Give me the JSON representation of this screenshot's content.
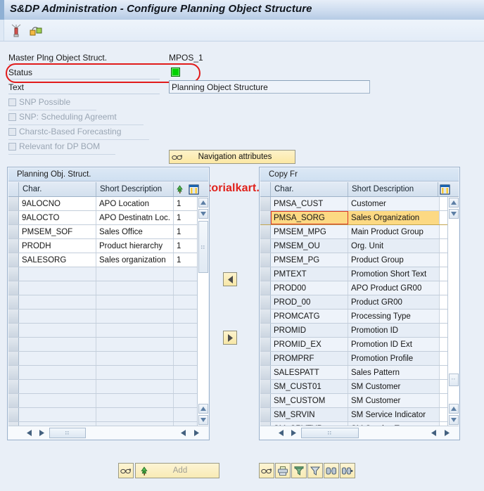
{
  "window": {
    "title": "S&DP Administration - Configure Planning Object Structure"
  },
  "toolbar": {
    "icons": [
      {
        "name": "hierarchy-display-icon",
        "title": "Display"
      },
      {
        "name": "objects-link-icon",
        "title": "Objects"
      }
    ]
  },
  "form": {
    "mpos": {
      "label": "Master Plng Object Struct.",
      "value": "MPOS_1"
    },
    "status": {
      "label": "Status",
      "led_color": "#00d200",
      "highlighted": true
    },
    "text": {
      "label": "Text",
      "value": "Planning Object Structure",
      "placeholder": ""
    },
    "checkboxes": [
      {
        "label": "SNP Possible",
        "checked": false,
        "enabled": false
      },
      {
        "label": "SNP: Scheduling Agreemt",
        "checked": false,
        "enabled": false
      },
      {
        "label": "Charstc-Based Forecasting",
        "checked": false,
        "enabled": false
      },
      {
        "label": "Relevant for DP BOM",
        "checked": false,
        "enabled": false
      }
    ],
    "nav_button": {
      "label": "Navigation attributes",
      "icon": "glasses-icon"
    },
    "watermark": "www.tutorialkart.com"
  },
  "left_panel": {
    "caption": "Planning Obj. Struct.",
    "columns": [
      {
        "label": "Char.",
        "name": "char"
      },
      {
        "label": "Short Description",
        "name": "short-description"
      },
      {
        "label": "C",
        "name": "c",
        "icon": "hierarchy-tree-icon"
      }
    ],
    "config_icon": "table-settings-icon",
    "rows": [
      {
        "char": "9ALOCNO",
        "desc": "APO Location",
        "c": "1"
      },
      {
        "char": "9ALOCTO",
        "desc": "APO Destinatn Loc.",
        "c": "1"
      },
      {
        "char": "PMSEM_SOF",
        "desc": "Sales Office",
        "c": "1"
      },
      {
        "char": "PRODH",
        "desc": "Product hierarchy",
        "c": "1"
      },
      {
        "char": "SALESORG",
        "desc": "Sales organization",
        "c": "1"
      },
      {
        "char": "",
        "desc": "",
        "c": ""
      },
      {
        "char": "",
        "desc": "",
        "c": ""
      },
      {
        "char": "",
        "desc": "",
        "c": ""
      },
      {
        "char": "",
        "desc": "",
        "c": ""
      },
      {
        "char": "",
        "desc": "",
        "c": ""
      },
      {
        "char": "",
        "desc": "",
        "c": ""
      },
      {
        "char": "",
        "desc": "",
        "c": ""
      },
      {
        "char": "",
        "desc": "",
        "c": ""
      },
      {
        "char": "",
        "desc": "",
        "c": ""
      },
      {
        "char": "",
        "desc": "",
        "c": ""
      },
      {
        "char": "",
        "desc": "",
        "c": ""
      },
      {
        "char": "",
        "desc": "",
        "c": ""
      }
    ]
  },
  "right_panel": {
    "caption": "Copy Fr",
    "columns": [
      {
        "label": "Char.",
        "name": "char"
      },
      {
        "label": "Short Description",
        "name": "short-description"
      }
    ],
    "config_icon": "table-settings-icon",
    "selected_row_index": 1,
    "rows": [
      {
        "char": "PMSA_CUST",
        "desc": "Customer"
      },
      {
        "char": "PMSA_SORG",
        "desc": "Sales Organization"
      },
      {
        "char": "PMSEM_MPG",
        "desc": "Main Product Group"
      },
      {
        "char": "PMSEM_OU",
        "desc": "Org. Unit"
      },
      {
        "char": "PMSEM_PG",
        "desc": "Product Group"
      },
      {
        "char": "PMTEXT",
        "desc": "Promotion Short Text"
      },
      {
        "char": "PROD00",
        "desc": "APO Product GR00"
      },
      {
        "char": "PROD_00",
        "desc": "Product GR00"
      },
      {
        "char": "PROMCATG",
        "desc": "Processing Type"
      },
      {
        "char": "PROMID",
        "desc": "Promotion ID"
      },
      {
        "char": "PROMID_EX",
        "desc": "Promotion ID Ext"
      },
      {
        "char": "PROMPRF",
        "desc": "Promotion Profile"
      },
      {
        "char": "SALESPATT",
        "desc": "Sales Pattern"
      },
      {
        "char": "SM_CUST01",
        "desc": "SM Customer"
      },
      {
        "char": "SM_CUSTOM",
        "desc": "SM Customer"
      },
      {
        "char": "SM_SRVIN",
        "desc": "SM Service Indicator"
      },
      {
        "char": "SM_SRVTYP",
        "desc": "SM Service Type"
      }
    ]
  },
  "transfer": {
    "move_left_label": "◀",
    "move_right_label": "▶"
  },
  "bottom": {
    "add_group": {
      "glasses_icon": "glasses-icon",
      "tree_icon": "hierarchy-tree-icon",
      "add_label": "Add",
      "add_enabled": false
    },
    "right_toolbar": [
      {
        "name": "glasses-icon",
        "title": "Display"
      },
      {
        "name": "print-icon",
        "title": "Print"
      },
      {
        "name": "filter-set-icon",
        "title": "Set Filter"
      },
      {
        "name": "filter-icon",
        "title": "Filter"
      },
      {
        "name": "find-icon",
        "title": "Find"
      },
      {
        "name": "find-next-icon",
        "title": "Find Next"
      }
    ]
  },
  "colors": {
    "accent_blue": "#b6cbe5",
    "selection_yellow": "#fcd983",
    "status_green": "#00d200",
    "watermark_red": "#e0211b"
  }
}
